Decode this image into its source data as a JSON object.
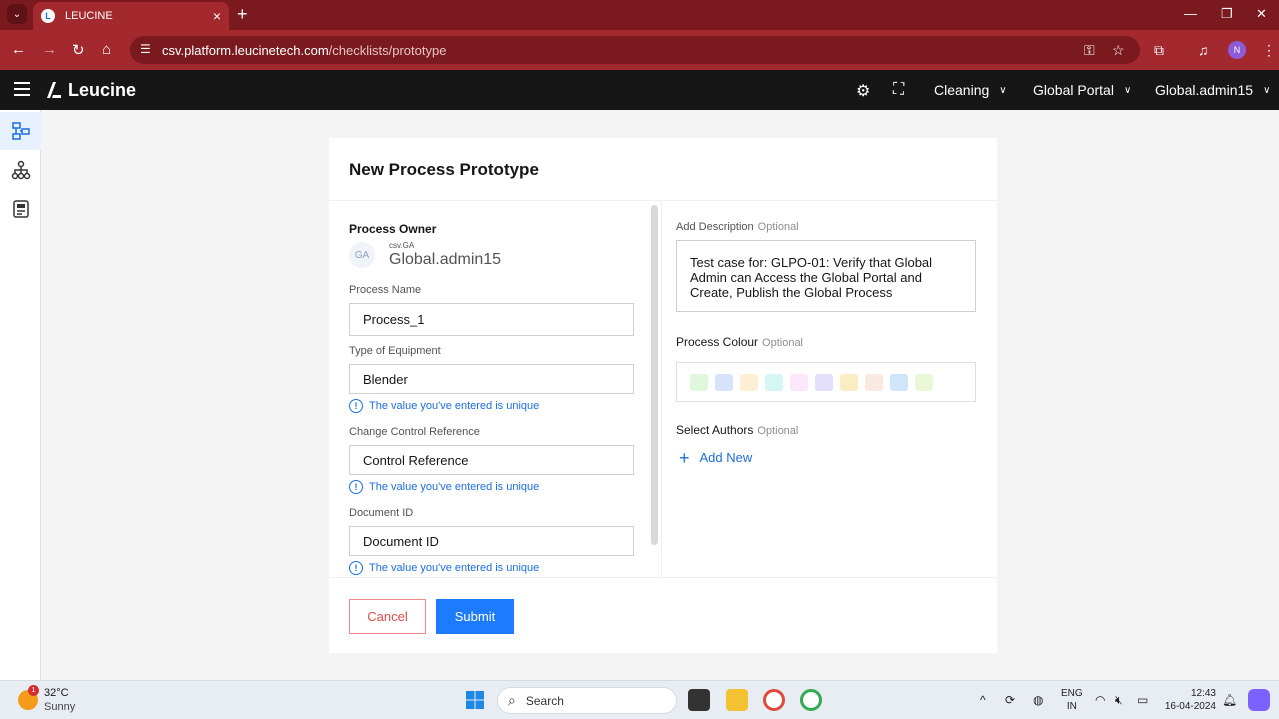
{
  "browser": {
    "tab_title": "LEUCINE",
    "url_host": "csv.platform.leucinetech.com",
    "url_path": "/checklists/prototype",
    "profile_initial": "N"
  },
  "appbar": {
    "brand": "Leucine",
    "facility": "Cleaning",
    "portal": "Global Portal",
    "user": "Global.admin15"
  },
  "form": {
    "title": "New Process Prototype",
    "owner": {
      "label": "Process Owner",
      "initials": "GA",
      "small": "csv.GA",
      "name": "Global.admin15"
    },
    "process_name": {
      "label": "Process Name",
      "value": "Process_1"
    },
    "equipment": {
      "label": "Type of Equipment",
      "value": "Blender",
      "hint": "The value you've entered is unique"
    },
    "change_control": {
      "label": "Change Control Reference",
      "value": "Control Reference",
      "hint": "The value you've entered is unique"
    },
    "document_id": {
      "label": "Document ID",
      "value": "Document ID",
      "hint": "The value you've entered is unique"
    },
    "description": {
      "label": "Add Description",
      "optional": "Optional",
      "value": "Test case for: GLPO-01: Verify that Global Admin can Access the Global Portal and Create, Publish the Global Process"
    },
    "colour": {
      "label": "Process Colour",
      "optional": "Optional",
      "swatches": [
        "#dff8dd",
        "#d7e3fb",
        "#fcefd3",
        "#d4f7f4",
        "#fbe6fb",
        "#e3defc",
        "#faedc2",
        "#f8e9e2",
        "#cfe5fa",
        "#eaf7d8"
      ]
    },
    "authors": {
      "label": "Select Authors",
      "optional": "Optional",
      "add_new": "Add New"
    },
    "cancel": "Cancel",
    "submit": "Submit"
  },
  "taskbar": {
    "temperature": "32°C",
    "condition": "Sunny",
    "weather_badge": "1",
    "search": "Search",
    "lang_top": "ENG",
    "lang_bottom": "IN",
    "time": "12:43",
    "date": "16-04-2024"
  }
}
